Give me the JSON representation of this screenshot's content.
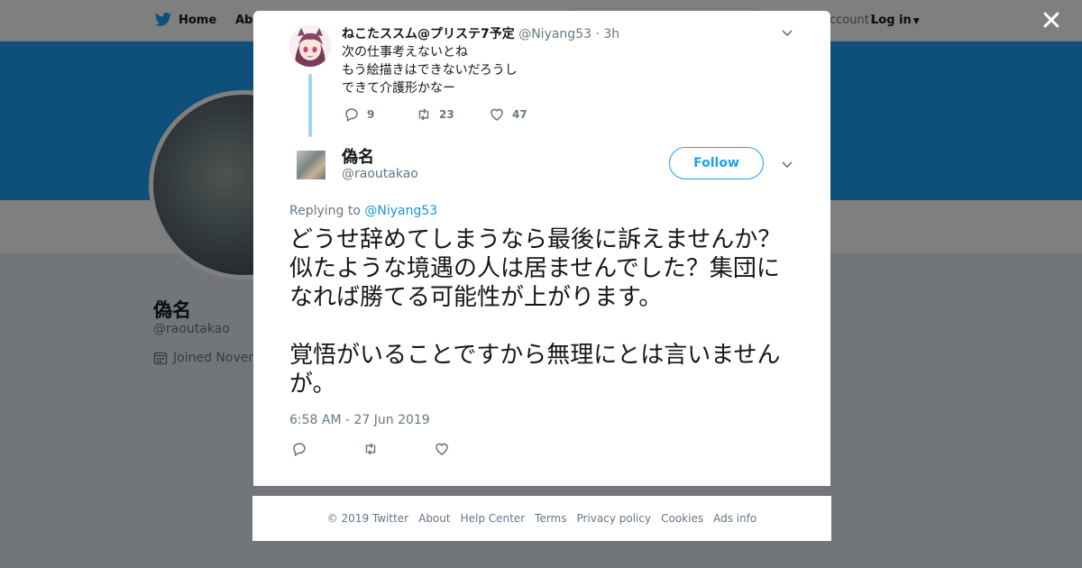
{
  "background": {
    "nav": {
      "home_label": "Home",
      "about_label": "Abo",
      "account_prompt": "account?",
      "login_label": "Log in"
    },
    "profile": {
      "name": "偽名",
      "handle": "@raoutakao",
      "joined": "Joined Novem"
    }
  },
  "modal": {
    "parent_tweet": {
      "name": "ねこたススム@プリステ7予定",
      "handle": "@Niyang53",
      "separator": "·",
      "time": "3h",
      "lines": [
        "次の仕事考えないとね",
        "もう絵描きはできないだろうし",
        "できて介護形かなー"
      ],
      "replies": "9",
      "retweets": "23",
      "likes": "47"
    },
    "main_tweet": {
      "name": "偽名",
      "handle": "@raoutakao",
      "follow_label": "Follow",
      "replying_prefix": "Replying to",
      "replying_to": "@Niyang53",
      "paragraph1": "どうせ辞めてしまうなら最後に訴えませんか？似たような境遇の人は居ませんでした？集団になれば勝てる可能性が上がります。",
      "paragraph2": "覚悟がいることですから無理にとは言いませんが。",
      "timestamp": "6:58 AM - 27 Jun 2019"
    }
  },
  "footer": {
    "copyright": "© 2019 Twitter",
    "links": [
      "About",
      "Help Center",
      "Terms",
      "Privacy policy",
      "Cookies",
      "Ads info"
    ]
  },
  "colors": {
    "brand_blue": "#1da1f2",
    "link_blue": "#1b95e0",
    "secondary_text": "#657786",
    "thread_line": "#9ed7f5"
  },
  "icons": {
    "brand": "twitter-bird-icon",
    "close": "close-icon",
    "reply": "reply-icon",
    "retweet": "retweet-icon",
    "like": "heart-icon",
    "menu": "chevron-down-icon",
    "calendar": "calendar-icon"
  }
}
